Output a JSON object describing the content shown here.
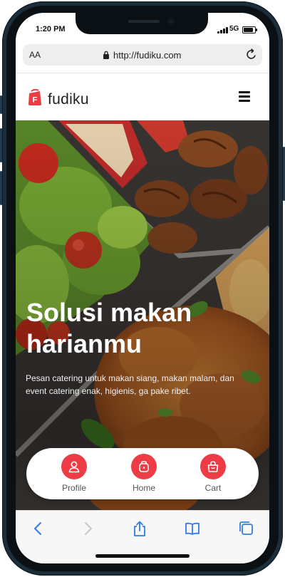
{
  "status": {
    "time": "1:20 PM",
    "network": "5G"
  },
  "browser": {
    "text_size_label": "AA",
    "url": "http://fudiku.com"
  },
  "site": {
    "logo_letter": "F",
    "logo_text": "fudiku"
  },
  "hero": {
    "title": "Solusi makan harianmu",
    "description": "Pesan catering untuk makan siang, makan malam, dan event catering enak, higienis, ga pake ribet."
  },
  "bottom_nav": {
    "items": [
      {
        "label": "Profile",
        "icon": "user-icon"
      },
      {
        "label": "Home",
        "icon": "home-icon"
      },
      {
        "label": "Cart",
        "icon": "bag-icon"
      }
    ]
  },
  "colors": {
    "brand_red": "#ed3c45",
    "frame": "#1c2e3a"
  }
}
